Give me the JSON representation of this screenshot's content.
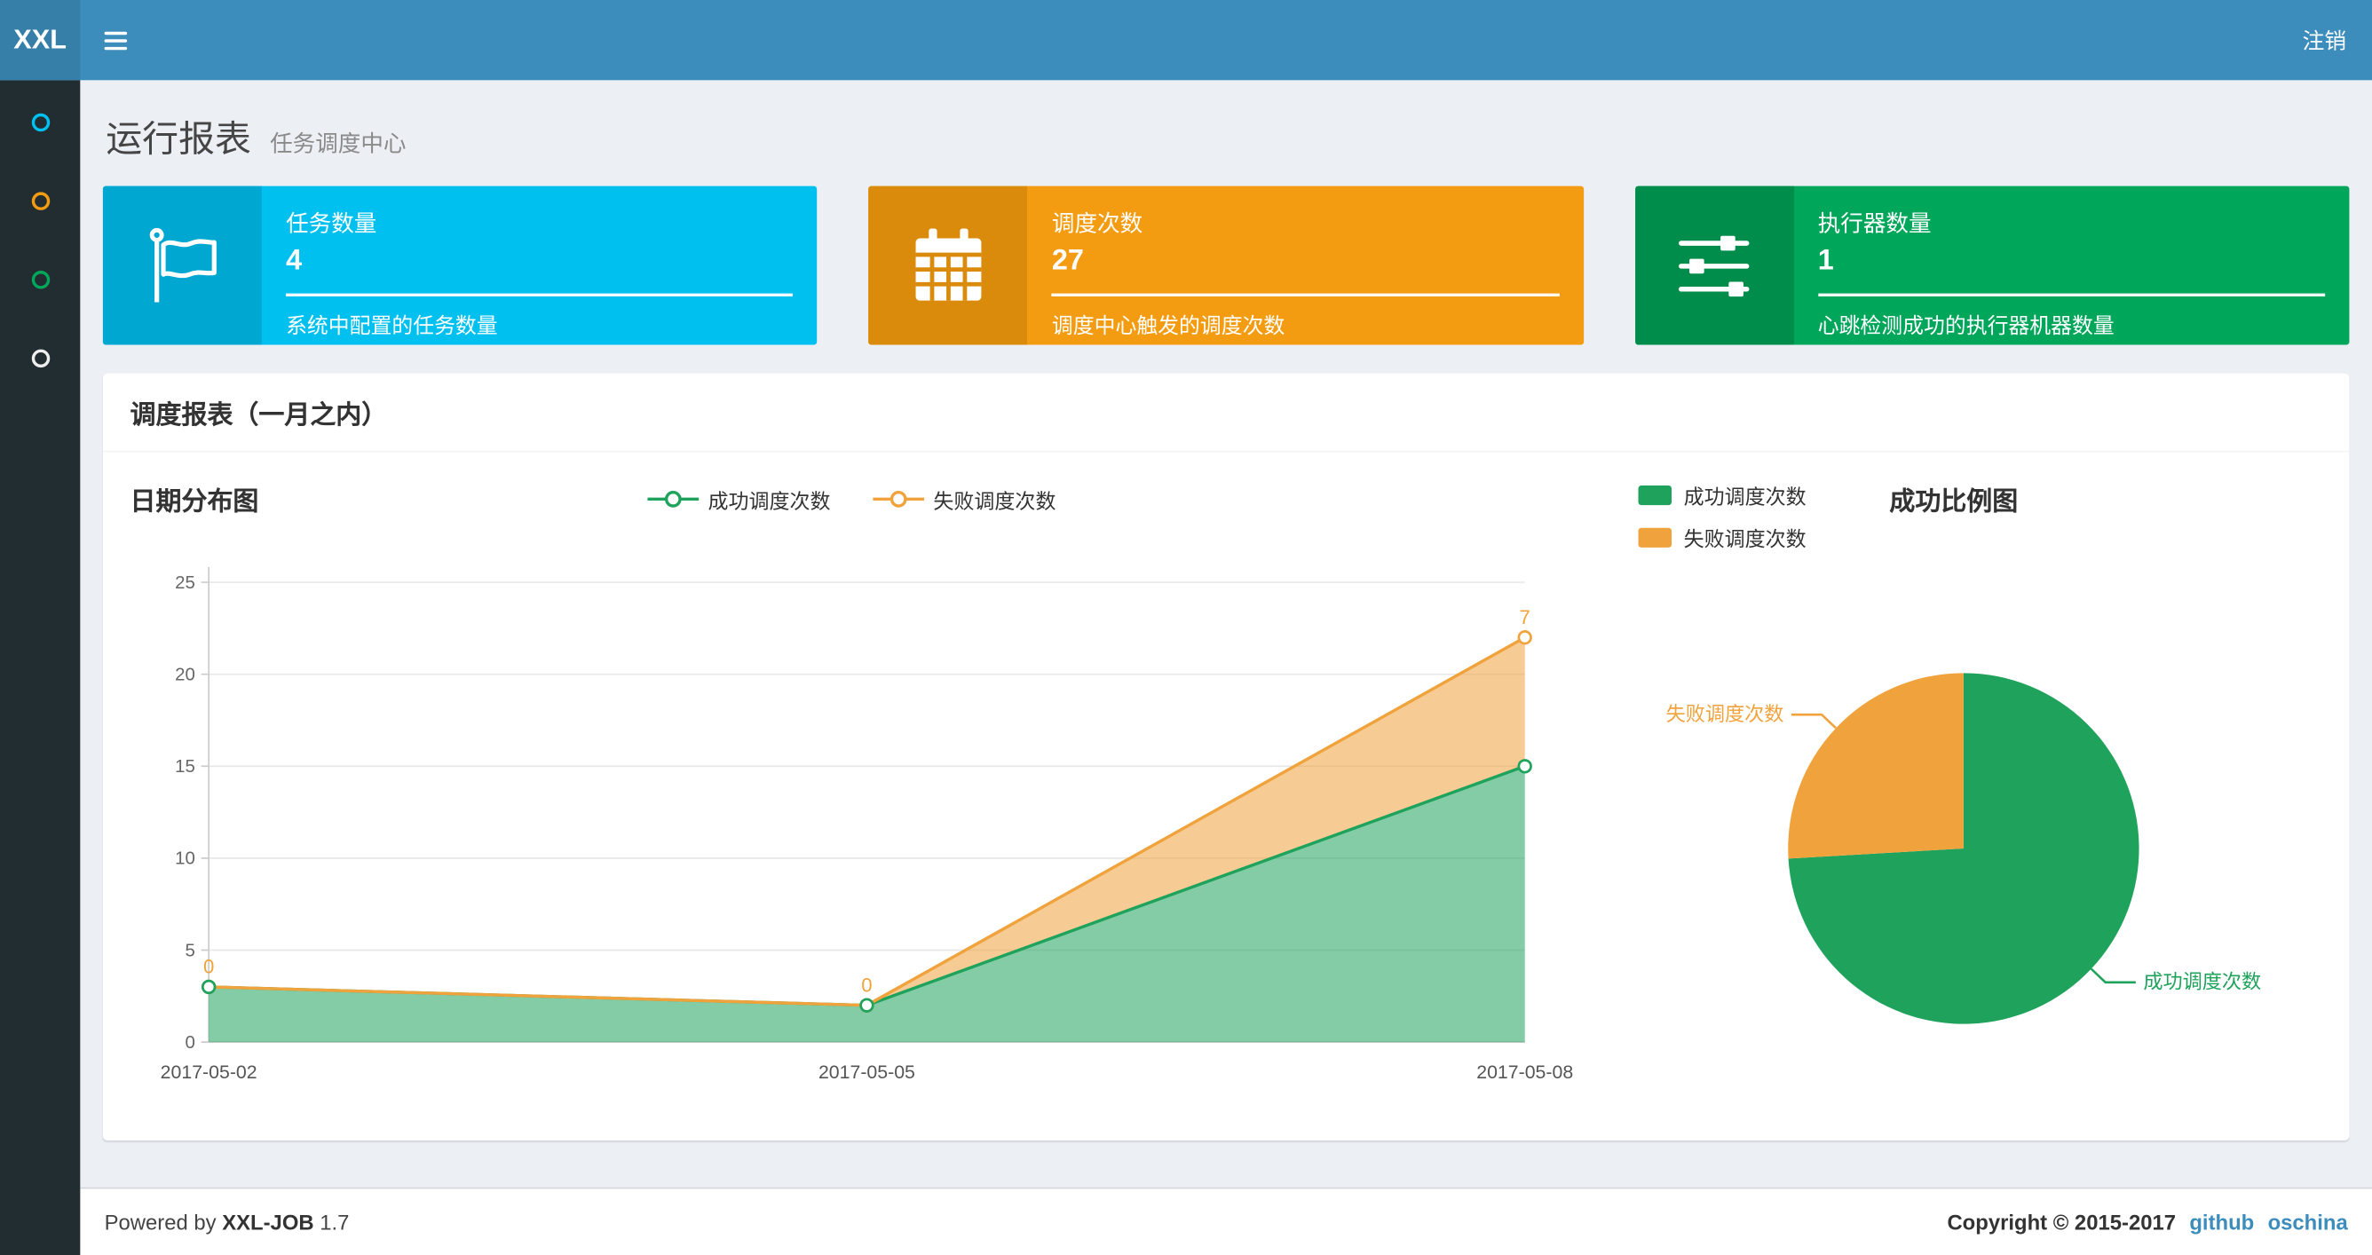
{
  "navbar": {
    "logo": "XXL",
    "logout_label": "注销"
  },
  "sidebar": {
    "items": [
      {
        "name": "menu-1",
        "icon": "circle-icon",
        "color": "#00c0ef"
      },
      {
        "name": "menu-2",
        "icon": "circle-icon",
        "color": "#f39c12"
      },
      {
        "name": "menu-3",
        "icon": "circle-icon",
        "color": "#00a65a"
      },
      {
        "name": "menu-4",
        "icon": "circle-icon",
        "color": "#eeeeee"
      }
    ]
  },
  "page_header": {
    "title": "运行报表",
    "subtitle": "任务调度中心"
  },
  "info_boxes": [
    {
      "title": "任务数量",
      "number": "4",
      "description": "系统中配置的任务数量",
      "bg": "#00c0ef",
      "icon_bg": "#00a7d0",
      "icon": "flag-icon"
    },
    {
      "title": "调度次数",
      "number": "27",
      "description": "调度中心触发的调度次数",
      "bg": "#f39c12",
      "icon_bg": "#db8b0b",
      "icon": "calendar-icon"
    },
    {
      "title": "执行器数量",
      "number": "1",
      "description": "心跳检测成功的执行器机器数量",
      "bg": "#00a65a",
      "icon_bg": "#008d4c",
      "icon": "sliders-icon"
    }
  ],
  "panel": {
    "title": "调度报表（一月之内）"
  },
  "chart_data": [
    {
      "type": "area",
      "title": "日期分布图",
      "x": [
        "2017-05-02",
        "2017-05-05",
        "2017-05-08"
      ],
      "series": [
        {
          "name": "成功调度次数",
          "values": [
            3,
            2,
            15
          ],
          "color": "#1fa25b",
          "stacked": false
        },
        {
          "name": "失败调度次数",
          "values": [
            0,
            0,
            7
          ],
          "color": "#f0a33c",
          "stacked": true
        }
      ],
      "point_labels": [
        "0",
        "0",
        "7"
      ],
      "ylim": [
        0,
        25
      ],
      "yticks": [
        0,
        5,
        10,
        15,
        20,
        25
      ],
      "grid": true,
      "legend_position": "top"
    },
    {
      "type": "pie",
      "title": "成功比例图",
      "slices": [
        {
          "name": "成功调度次数",
          "value": 20,
          "color": "#1fa25b"
        },
        {
          "name": "失败调度次数",
          "value": 7,
          "color": "#f0a33c"
        }
      ],
      "legend_position": "top-left"
    }
  ],
  "footer": {
    "powered_by": "Powered by",
    "brand": "XXL-JOB",
    "version": "1.7",
    "copyright": "Copyright © 2015-2017",
    "links": [
      {
        "label": "github"
      },
      {
        "label": "oschina"
      }
    ]
  }
}
